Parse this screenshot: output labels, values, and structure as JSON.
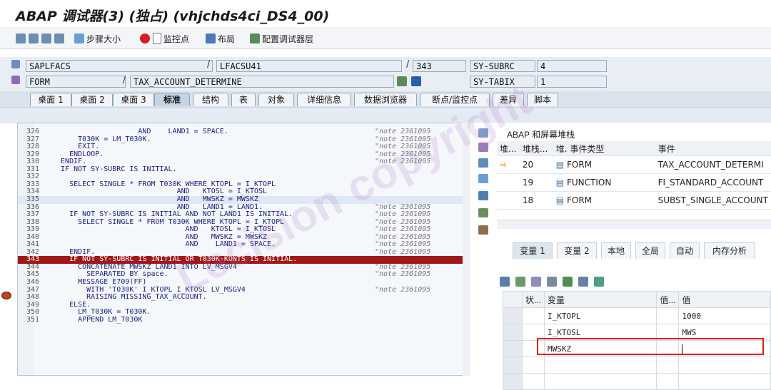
{
  "window": {
    "title": "ABAP 调试器(3)  (独占) (vhjchds4ci_DS4_00)"
  },
  "toolbar": {
    "step_size": "步骤大小",
    "watchpoint": "监控点",
    "layout": "布局",
    "configure_layers": "配置调试器层"
  },
  "info": {
    "program": "SAPLFACS",
    "include": "LFACSU41",
    "line": "343",
    "type": "FORM",
    "event": "TAX_ACCOUNT_DETERMINE",
    "sy1_name": "SY-SUBRC",
    "sy1_value": "4",
    "sy2_name": "SY-TABIX",
    "sy2_value": "1"
  },
  "tabs": [
    "桌面 1",
    "桌面 2",
    "桌面 3",
    "标准",
    "结构",
    "表",
    "对象",
    "详细信息",
    "数据浏览器",
    "断点/监控点",
    "差异",
    "脚本"
  ],
  "code": [
    {
      "ln": "326",
      "code": "                    AND    LAND1 = SPACE.",
      "note": "\"note 2361095"
    },
    {
      "ln": "327",
      "code": "      T030K = LM_T030K.",
      "note": "\"note 2361095"
    },
    {
      "ln": "328",
      "code": "      EXIT.",
      "note": "\"note 2361095"
    },
    {
      "ln": "329",
      "code": "    ENDLOOP.",
      "note": "\"note 2361095"
    },
    {
      "ln": "330",
      "code": "  ENDIF.",
      "note": "\"note 2361095"
    },
    {
      "ln": "331",
      "code": "  IF NOT SY-SUBRC IS INITIAL.",
      "note": ""
    },
    {
      "ln": "332",
      "code": "",
      "note": ""
    },
    {
      "ln": "333",
      "code": "    SELECT SINGLE * FROM T030K WHERE KTOPL = I_KTOPL",
      "note": ""
    },
    {
      "ln": "334",
      "code": "                             AND   KTOSL = I_KTOSL",
      "note": ""
    },
    {
      "ln": "335",
      "code": "                             AND   MWSKZ = MWSKZ",
      "note": ""
    },
    {
      "ln": "336",
      "code": "                             AND   LAND1 = LAND1.",
      "note": "\"note 2361095"
    },
    {
      "ln": "337",
      "code": "    IF NOT SY-SUBRC IS INITIAL AND NOT LAND1 IS INITIAL.",
      "note": "\"note 2361095"
    },
    {
      "ln": "338",
      "code": "      SELECT SINGLE * FROM T030K WHERE KTOPL = I_KTOPL",
      "note": "\"note 2361095"
    },
    {
      "ln": "339",
      "code": "                               AND   KTOSL = I_KTOSL",
      "note": "\"note 2361095"
    },
    {
      "ln": "340",
      "code": "                               AND   MWSKZ = MWSKZ",
      "note": "\"note 2361095"
    },
    {
      "ln": "341",
      "code": "                               AND    LAND1 = SPACE.",
      "note": "\"note 2361095"
    },
    {
      "ln": "342",
      "code": "    ENDIF.",
      "note": "\"note 2361095"
    },
    {
      "ln": "343",
      "code": "    IF NOT SY-SUBRC IS INITIAL OR T030K-KONTS IS INITIAL.",
      "note": ""
    },
    {
      "ln": "344",
      "code": "      CONCATENATE MWSKZ LAND1 INTO LV_MSGV4",
      "note": "\"note 2361095"
    },
    {
      "ln": "345",
      "code": "        SEPARATED BY space.",
      "note": "\"note 2361095"
    },
    {
      "ln": "346",
      "code": "      MESSAGE E709(FF)",
      "note": ""
    },
    {
      "ln": "347",
      "code": "        WITH 'T030K' I_KTOPL I_KTOSL LV_MSGV4",
      "note": "\"note 2361095"
    },
    {
      "ln": "348",
      "code": "        RAISING MISSING_TAX_ACCOUNT.",
      "note": ""
    },
    {
      "ln": "349",
      "code": "    ELSE.",
      "note": ""
    },
    {
      "ln": "350",
      "code": "      LM_T030K = T030K.",
      "note": ""
    },
    {
      "ln": "351",
      "code": "      APPEND LM_T030K",
      "note": ""
    }
  ],
  "stack": {
    "title": "ABAP 和屏幕堆栈",
    "headers": [
      "堆...",
      "堆栈...",
      "堆. 事件类型",
      "事件"
    ],
    "rows": [
      {
        "level": "20",
        "type": "FORM",
        "event": "TAX_ACCOUNT_DETERMI"
      },
      {
        "level": "19",
        "type": "FUNCTION",
        "event": "FI_STANDARD_ACCOUNT"
      },
      {
        "level": "18",
        "type": "FORM",
        "event": "SUBST_SINGLE_ACCOUNT"
      }
    ]
  },
  "vartabs": [
    "变量 1",
    "变量 2",
    "本地",
    "全局",
    "自动",
    "内存分析"
  ],
  "vars": {
    "headers": [
      "状...",
      "变量",
      "值...",
      "值"
    ],
    "rows": [
      {
        "name": "I_KTOPL",
        "value": "1000"
      },
      {
        "name": "I_KTOSL",
        "value": "MWS"
      },
      {
        "name": "MWSKZ",
        "value": ""
      }
    ]
  },
  "watermark": "Lecision copyright",
  "colors": {
    "breakpoint_line": "#a01818",
    "highlight_box": "#e02020"
  }
}
